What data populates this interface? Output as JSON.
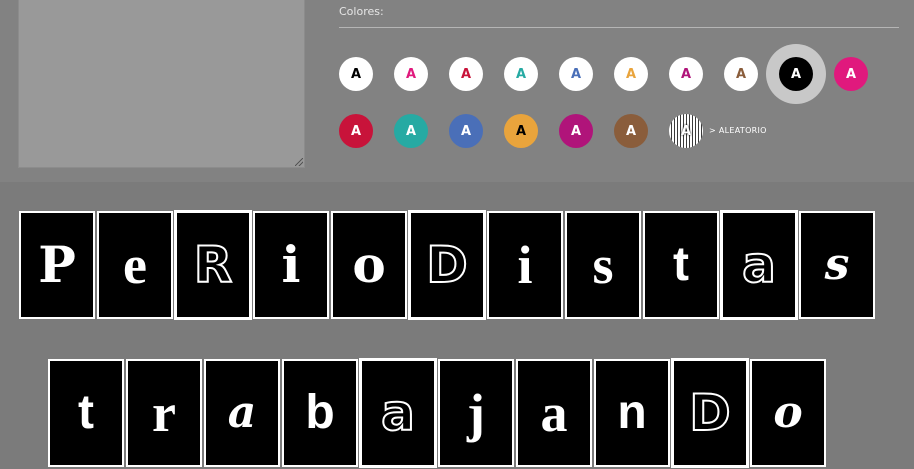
{
  "colors_label": "Colores:",
  "swatches_row1": [
    {
      "letter": "A",
      "bg": "#ffffff",
      "fg": "#000000"
    },
    {
      "letter": "A",
      "bg": "#ffffff",
      "fg": "#e0197d"
    },
    {
      "letter": "A",
      "bg": "#ffffff",
      "fg": "#c8133a"
    },
    {
      "letter": "A",
      "bg": "#ffffff",
      "fg": "#26aaa3"
    },
    {
      "letter": "A",
      "bg": "#ffffff",
      "fg": "#4a6fb8"
    },
    {
      "letter": "A",
      "bg": "#ffffff",
      "fg": "#e9a43c"
    },
    {
      "letter": "A",
      "bg": "#ffffff",
      "fg": "#b0147a"
    },
    {
      "letter": "A",
      "bg": "#ffffff",
      "fg": "#8a5d3b"
    },
    {
      "letter": "A",
      "bg": "#000000",
      "fg": "#ffffff",
      "selected": true
    },
    {
      "letter": "A",
      "bg": "#e0197d",
      "fg": "#ffffff"
    }
  ],
  "swatches_row2": [
    {
      "letter": "A",
      "bg": "#c8133a",
      "fg": "#ffffff"
    },
    {
      "letter": "A",
      "bg": "#26aaa3",
      "fg": "#ffffff"
    },
    {
      "letter": "A",
      "bg": "#4a6fb8",
      "fg": "#ffffff"
    },
    {
      "letter": "A",
      "bg": "#e9a43c",
      "fg": "#000000"
    },
    {
      "letter": "A",
      "bg": "#b0147a",
      "fg": "#ffffff"
    },
    {
      "letter": "A",
      "bg": "#8a5d3b",
      "fg": "#ffffff"
    },
    {
      "letter": "A",
      "random": true
    }
  ],
  "random_label": "> ALEATORIO",
  "word1": [
    {
      "letter": "P",
      "style": "slab"
    },
    {
      "letter": "e",
      "style": "serif"
    },
    {
      "letter": "R",
      "style": "line"
    },
    {
      "letter": "i",
      "style": "slab"
    },
    {
      "letter": "o",
      "style": "slab"
    },
    {
      "letter": "D",
      "style": "line"
    },
    {
      "letter": "i",
      "style": "serif"
    },
    {
      "letter": "s",
      "style": "serif"
    },
    {
      "letter": "t",
      "style": "sans"
    },
    {
      "letter": "a",
      "style": "line"
    },
    {
      "letter": "s",
      "style": "rough"
    }
  ],
  "word2": [
    {
      "letter": "t",
      "style": "sans"
    },
    {
      "letter": "r",
      "style": "serif"
    },
    {
      "letter": "a",
      "style": "rough"
    },
    {
      "letter": "b",
      "style": "sans"
    },
    {
      "letter": "a",
      "style": "line"
    },
    {
      "letter": "j",
      "style": "serif"
    },
    {
      "letter": "a",
      "style": "serif"
    },
    {
      "letter": "n",
      "style": "sans"
    },
    {
      "letter": "D",
      "style": "line"
    },
    {
      "letter": "o",
      "style": "rough"
    }
  ]
}
